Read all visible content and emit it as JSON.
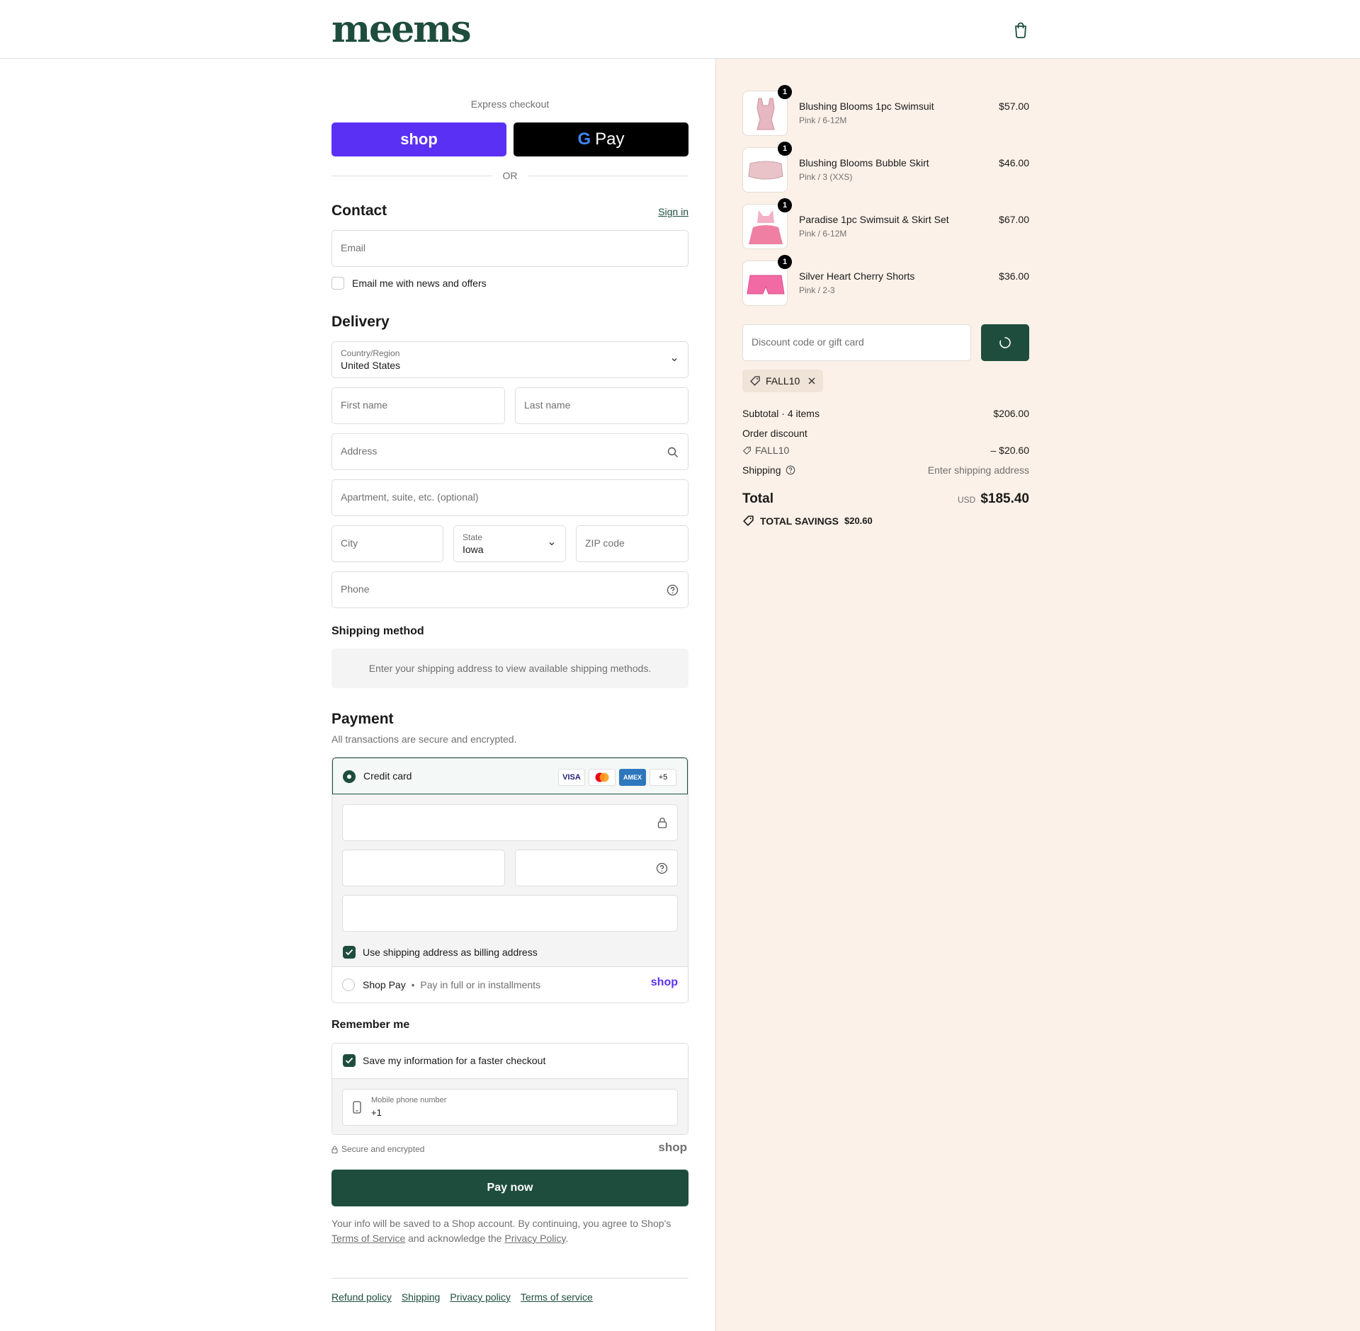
{
  "header": {
    "logo": "meems",
    "cart_icon": "shopping-bag-icon"
  },
  "express": {
    "title": "Express checkout",
    "shop_label": "shop",
    "gpay_g": "G",
    "gpay_label": "Pay",
    "or": "OR"
  },
  "contact": {
    "title": "Contact",
    "sign_in": "Sign in",
    "email_placeholder": "Email",
    "news_label": "Email me with news and offers"
  },
  "delivery": {
    "title": "Delivery",
    "country_label": "Country/Region",
    "country_value": "United States",
    "first_name": "First name",
    "last_name": "Last name",
    "address": "Address",
    "apartment": "Apartment, suite, etc. (optional)",
    "city": "City",
    "state_label": "State",
    "state_value": "Iowa",
    "zip": "ZIP code",
    "phone": "Phone"
  },
  "shipping_method": {
    "title": "Shipping method",
    "notice": "Enter your shipping address to view available shipping methods."
  },
  "payment": {
    "title": "Payment",
    "subtitle": "All transactions are secure and encrypted.",
    "credit_card": "Credit card",
    "cards": [
      "VISA",
      "MC",
      "AMEX",
      "+5"
    ],
    "billing_label": "Use shipping address as billing address",
    "shoppay_label": "Shop Pay",
    "shoppay_sep": "•",
    "shoppay_desc": "Pay in full or in installments",
    "shoppay_logo": "shop"
  },
  "remember": {
    "title": "Remember me",
    "save_label": "Save my information for a faster checkout",
    "mobile_label": "Mobile phone number",
    "mobile_value": "+1",
    "secure": "Secure and encrypted",
    "shop_logo": "shop"
  },
  "pay_now": "Pay now",
  "legal": {
    "text1": "Your info will be saved to a Shop account. By continuing, you agree to Shop's",
    "tos": "Terms of Service",
    "text2": "and acknowledge the",
    "privacy": "Privacy Policy",
    "end": "."
  },
  "footer_links": [
    "Refund policy",
    "Shipping",
    "Privacy policy",
    "Terms of service"
  ],
  "cart": {
    "items": [
      {
        "name": "Blushing Blooms 1pc Swimsuit",
        "variant": "Pink / 6-12M",
        "price": "$57.00",
        "qty": "1"
      },
      {
        "name": "Blushing Blooms Bubble Skirt",
        "variant": "Pink / 3 (XXS)",
        "price": "$46.00",
        "qty": "1"
      },
      {
        "name": "Paradise 1pc Swimsuit & Skirt Set",
        "variant": "Pink / 6-12M",
        "price": "$67.00",
        "qty": "1"
      },
      {
        "name": "Silver Heart Cherry Shorts",
        "variant": "Pink / 2-3",
        "price": "$36.00",
        "qty": "1"
      }
    ],
    "discount_placeholder": "Discount code or gift card",
    "applied_code": "FALL10",
    "subtotal_label": "Subtotal · 4 items",
    "subtotal": "$206.00",
    "order_discount_label": "Order discount",
    "discount_code": "FALL10",
    "discount_amount": "– $20.60",
    "shipping_label": "Shipping",
    "shipping_value": "Enter shipping address",
    "total_label": "Total",
    "currency": "USD",
    "total": "$185.40",
    "savings_label": "TOTAL SAVINGS",
    "savings": "$20.60"
  },
  "colors": {
    "brand": "#1e4d3e",
    "shop_purple": "#5a31f4",
    "summary_bg": "#fcf1e8"
  }
}
